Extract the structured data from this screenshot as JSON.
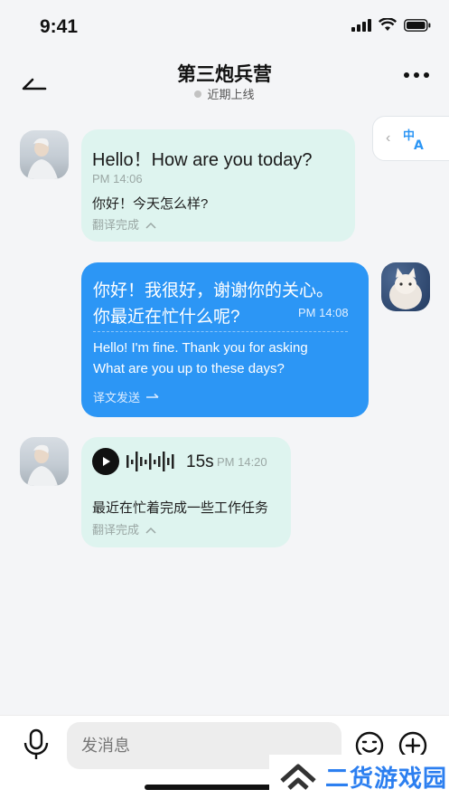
{
  "status_bar": {
    "time": "9:41"
  },
  "header": {
    "title": "第三炮兵营",
    "presence": "近期上线"
  },
  "translate_tab": {
    "icon": "translate-icon"
  },
  "messages": [
    {
      "original": "Hello！How are you today?",
      "time": "PM 14:06",
      "translation": "你好！今天怎么样?",
      "status": "翻译完成"
    },
    {
      "original_line1": "你好！我很好，谢谢你的关心。",
      "original_line2": "你最近在忙什么呢?",
      "time": "PM 14:08",
      "translation_line1": "Hello! I'm fine. Thank you for asking",
      "translation_line2": "What are you up to these days?",
      "status": "译文发送"
    },
    {
      "duration": "15s",
      "time": "PM 14:20",
      "translation": "最近在忙着完成一些工作任务",
      "status": "翻译完成"
    }
  ],
  "composer": {
    "placeholder": "发消息"
  },
  "watermark": {
    "text": "二货游戏园"
  },
  "colors": {
    "accent": "#2c96f5",
    "incoming_bubble": "#def4ef"
  }
}
